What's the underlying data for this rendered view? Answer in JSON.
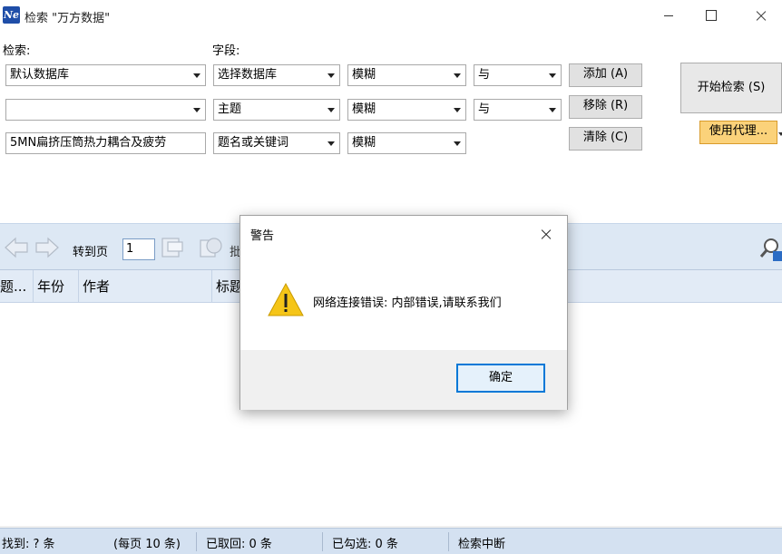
{
  "window": {
    "title": "检索 \"万方数据\"",
    "icon_text": "Ne"
  },
  "search": {
    "label_search": "检索:",
    "label_field": "字段:",
    "rows": [
      {
        "database": "默认数据库",
        "field": "选择数据库",
        "match": "模糊",
        "logic": "与"
      },
      {
        "database": "",
        "field": "主题",
        "match": "模糊",
        "logic": "与"
      },
      {
        "database": "5MN扁挤压筒热力耦合及疲劳",
        "field": "题名或关键词",
        "match": "模糊"
      }
    ],
    "buttons": {
      "add": "添加 (A)",
      "remove": "移除 (R)",
      "clear": "清除 (C)",
      "start": "开始检索 (S)",
      "proxy": "使用代理..."
    }
  },
  "toolbar": {
    "goto_label": "转到页",
    "page_value": "1",
    "batch_label": "批"
  },
  "table": {
    "columns": [
      "题...",
      "年份",
      "作者",
      "标题"
    ]
  },
  "status": {
    "found": "找到: ? 条",
    "per_page": "(每页 10 条)",
    "fetched": "已取回: 0 条",
    "checked": "已勾选: 0 条",
    "state": "检索中断"
  },
  "dialog": {
    "title": "警告",
    "message": "网络连接错误: 内部错误,请联系我们",
    "ok_label": "确定"
  },
  "colors": {
    "accent": "#0078d7",
    "proxy_button": "#fbd27a",
    "toolbar_bg": "#dde8f4",
    "warning": "#f5c518"
  },
  "icons": [
    "app-icon",
    "back-arrow-icon",
    "forward-arrow-icon",
    "goto-page-icon",
    "batch-icon",
    "find-icon",
    "warning-icon",
    "close-icon"
  ]
}
